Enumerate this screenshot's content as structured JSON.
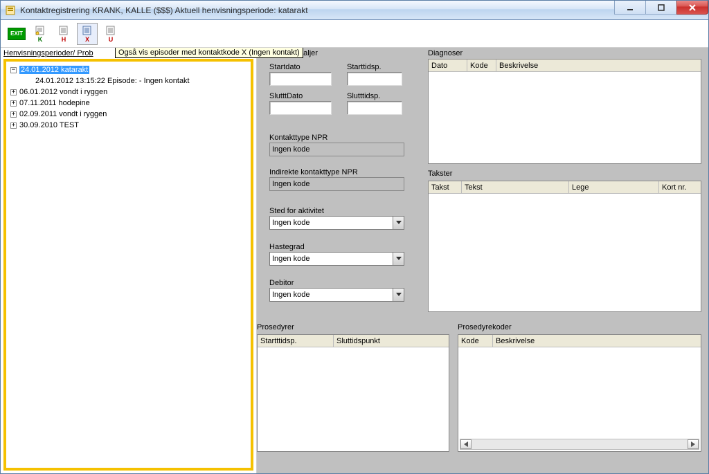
{
  "window": {
    "title": "Kontaktregistrering KRANK, KALLE ($$$)   Aktuell henvisningsperiode: katarakt"
  },
  "toolbar": {
    "exit": "EXIT",
    "k": "K",
    "h": "H",
    "x": "X",
    "u": "U"
  },
  "left": {
    "tab": "Henvisningsperioder/ Prob",
    "tooltip": "Også vis episoder med kontaktkode X (Ingen kontakt)",
    "tree": {
      "node0": "24.01.2012 katarakt",
      "node0_child": "24.01.2012 13:15:22 Episode: - Ingen kontakt",
      "node1": "06.01.2012 vondt i ryggen",
      "node2": "07.11.2011 hodepine",
      "node3": "02.09.2011 vondt i ryggen",
      "node4": "30.09.2010 TEST"
    }
  },
  "details": {
    "trailing_title": "etaljer",
    "startdato": "Startdato",
    "starttidsp": "Starttidsp.",
    "sluttdato": "SlutttDato",
    "slutttidsp": "Slutttidsp.",
    "kontakttype_label": "Kontakttype NPR",
    "kontakttype_value": "Ingen kode",
    "indirekte_label": "Indirekte kontakttype NPR",
    "indirekte_value": "Ingen kode",
    "sted_label": "Sted for aktivitet",
    "sted_value": "Ingen kode",
    "hastegrad_label": "Hastegrad",
    "hastegrad_value": "Ingen kode",
    "debitor_label": "Debitor",
    "debitor_value": "Ingen kode"
  },
  "diagnoser": {
    "title": "Diagnoser",
    "cols": {
      "dato": "Dato",
      "kode": "Kode",
      "beskrivelse": "Beskrivelse"
    }
  },
  "takster": {
    "title": "Takster",
    "cols": {
      "takst": "Takst",
      "tekst": "Tekst",
      "lege": "Lege",
      "kortnr": "Kort nr."
    }
  },
  "prosedyrer": {
    "title": "Prosedyrer",
    "cols": {
      "start": "Startttidsp.",
      "slutt": "Sluttidspunkt"
    }
  },
  "prosedyrekoder": {
    "title": "Prosedyrekoder",
    "cols": {
      "kode": "Kode",
      "beskrivelse": "Beskrivelse"
    }
  }
}
